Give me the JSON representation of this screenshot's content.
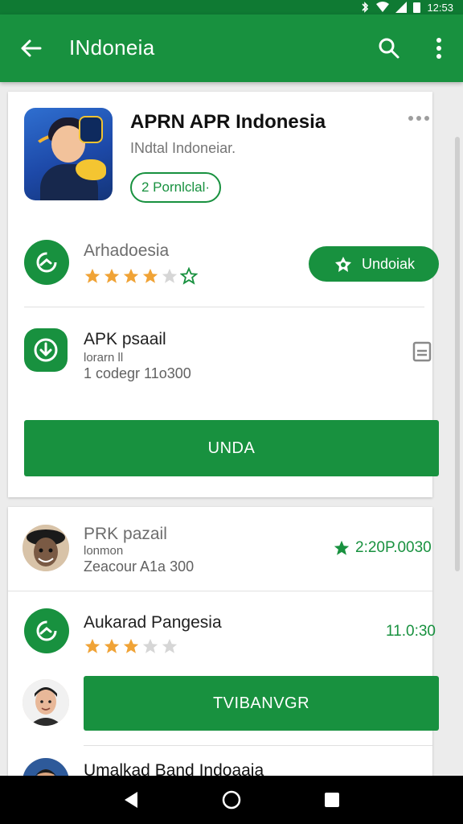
{
  "status_bar": {
    "time": "12:53"
  },
  "app_bar": {
    "title": "INdoneia"
  },
  "app": {
    "title": "APRN APR Indonesia",
    "subtitle": "INdtal Indoneiar.",
    "chip": "2 Pornlclal·"
  },
  "row1": {
    "title": "Arhadoesia",
    "rating": 4,
    "max_rating": 5,
    "button": "Undoiak"
  },
  "row2": {
    "title": "APK psaail",
    "line2": "lorarn ll",
    "line3": "1 codegr 11o300"
  },
  "primary_button": "UNDA",
  "list": [
    {
      "title": "PRK pazail",
      "line2": "lonmon",
      "line3": "Zeacour A1a 300",
      "price": "2:20P.0030"
    },
    {
      "title": "Aukarad Pangesia",
      "rating": 3,
      "max_rating": 5,
      "price": "11.0:30"
    },
    {
      "title": "Umalkad Band Indoaaia"
    }
  ],
  "secondary_button": "TVIBANVGR",
  "colors": {
    "primary": "#18913f",
    "status_bar": "#0f7a33",
    "star": "#f0a336",
    "star_empty": "#d6d6d6"
  },
  "icons": {
    "back": "arrow-left-icon",
    "search": "search-icon",
    "more": "more-vertical-icon",
    "update": "refresh-icon",
    "download": "download-icon",
    "book": "book-icon"
  }
}
